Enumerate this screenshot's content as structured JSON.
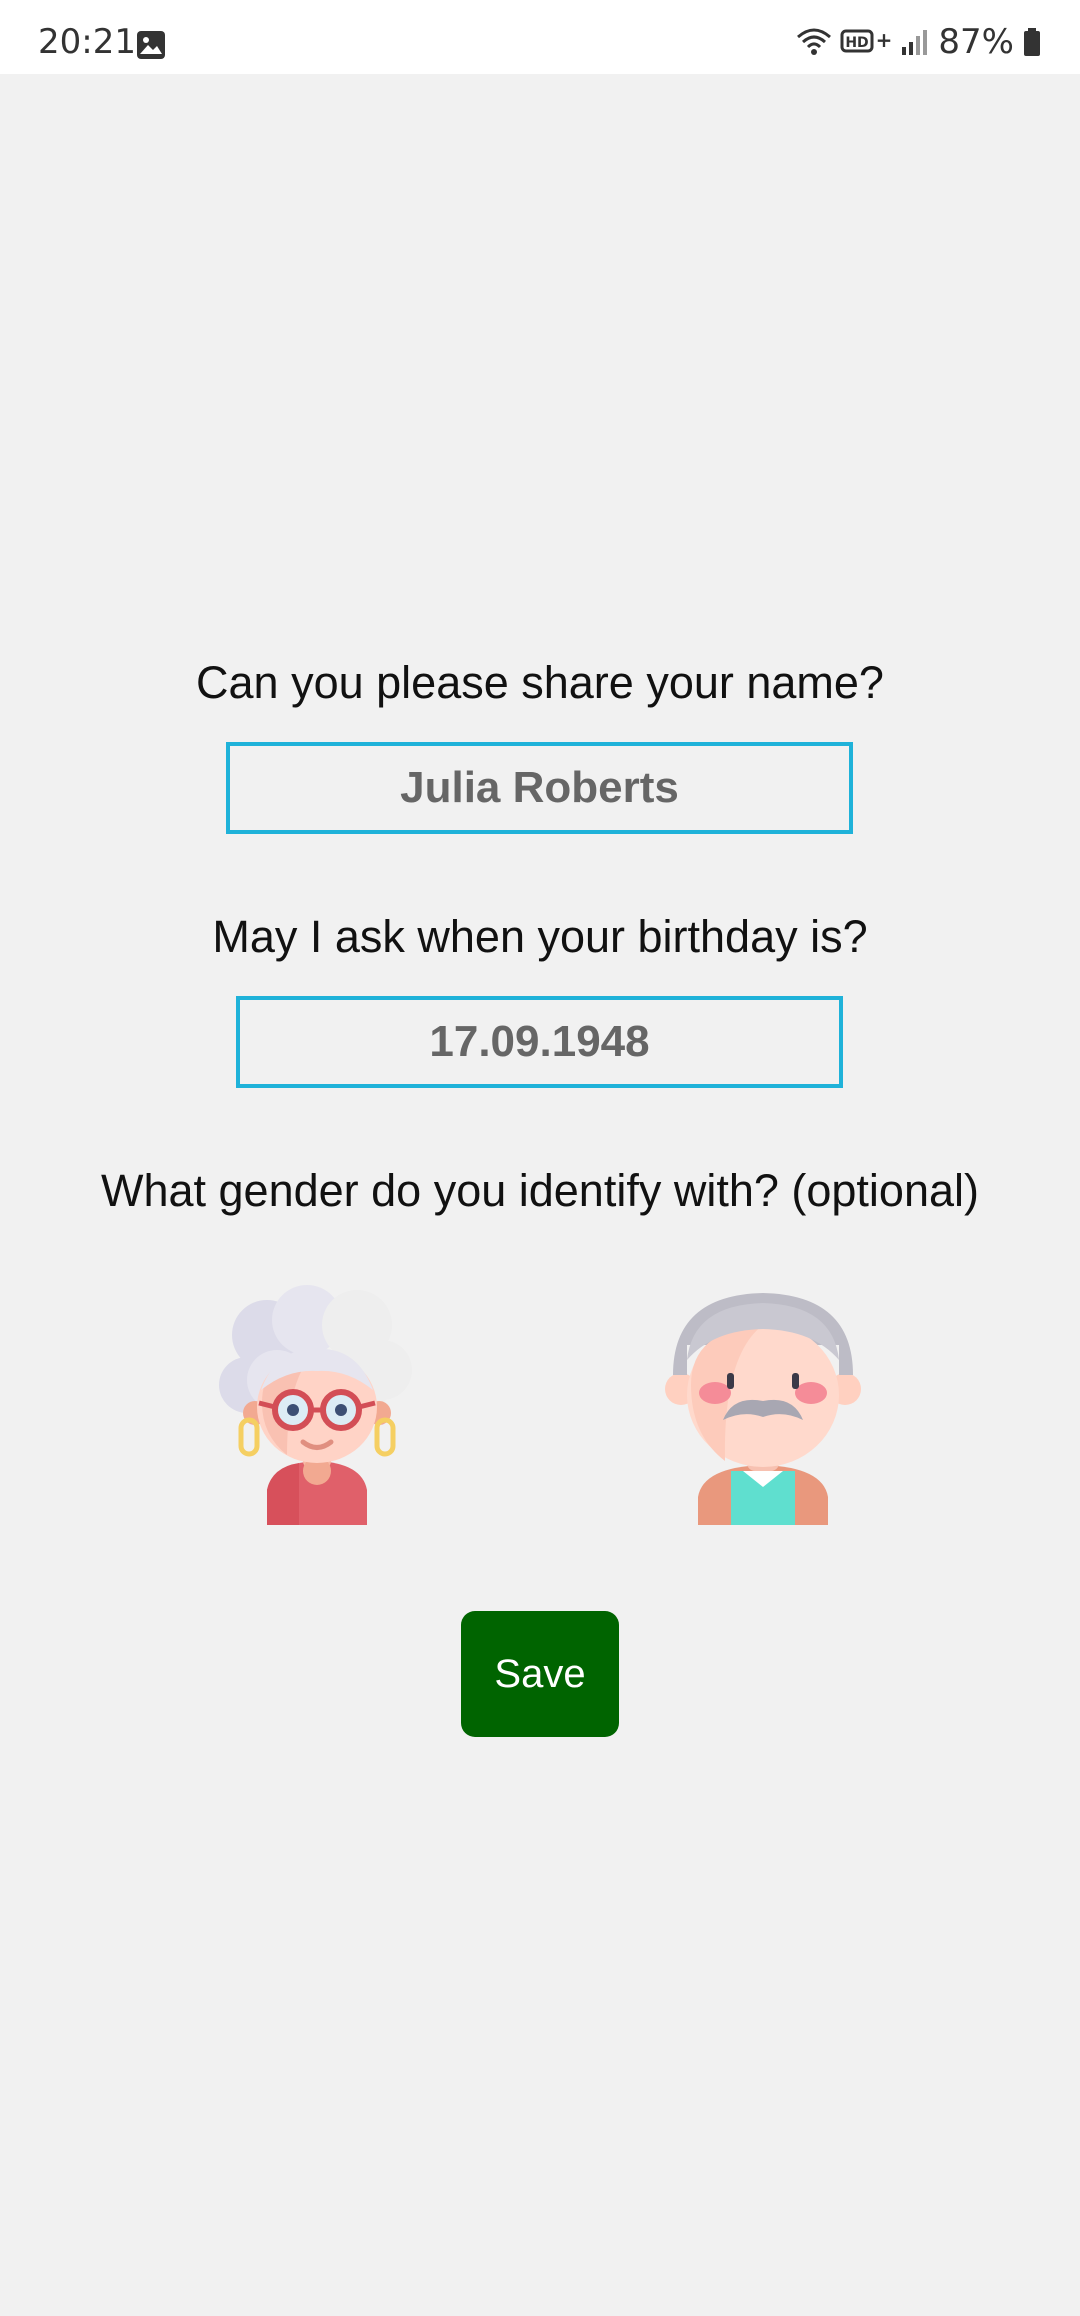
{
  "status_bar": {
    "time": "20:21",
    "battery": "87%",
    "icons": [
      "gallery-icon",
      "wifi-icon",
      "hd-plus-icon",
      "signal-icon",
      "battery-icon"
    ]
  },
  "form": {
    "name_question": "Can you please share your name?",
    "name_value": "Julia Roberts",
    "birthday_question": "May I ask when your birthday is?",
    "birthday_value": "17.09.1948",
    "gender_question": "What gender do you identify with? (optional)",
    "gender_options": [
      "female-avatar-icon",
      "male-avatar-icon"
    ],
    "save_label": "Save"
  },
  "colors": {
    "background": "#f1f1f1",
    "field_border": "#1fb2d9",
    "save_button": "#006400"
  }
}
